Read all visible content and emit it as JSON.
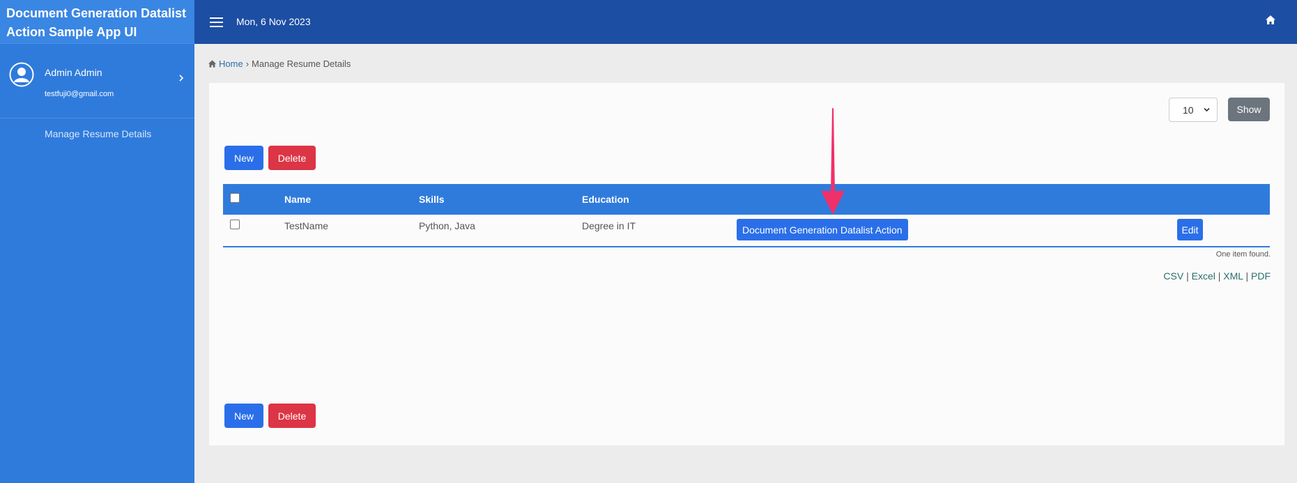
{
  "app": {
    "title": "Document Generation Datalist Action Sample App UI"
  },
  "user": {
    "name": "Admin Admin",
    "email": "testfuji0@gmail.com"
  },
  "sidebar": {
    "items": [
      {
        "label": "Manage Resume Details"
      }
    ]
  },
  "topbar": {
    "date": "Mon, 6 Nov 2023"
  },
  "breadcrumb": {
    "home": "Home",
    "separator": "›",
    "current": "Manage Resume Details"
  },
  "list": {
    "page_size": "10",
    "show_label": "Show",
    "new_label": "New",
    "delete_label": "Delete",
    "columns": {
      "name": "Name",
      "skills": "Skills",
      "education": "Education"
    },
    "rows": [
      {
        "name": "TestName",
        "skills": "Python, Java",
        "education": "Degree in IT",
        "action_label": "Document Generation Datalist Action",
        "edit_label": "Edit"
      }
    ],
    "items_found": "One item found.",
    "exports": {
      "csv": "CSV",
      "excel": "Excel",
      "xml": "XML",
      "pdf": "PDF",
      "separator": "|"
    }
  },
  "colors": {
    "sidebar": "#2f7bdc",
    "topbar": "#1c4ea3",
    "primary": "#2a6fe9",
    "danger": "#dc3545",
    "secondary": "#6c757d",
    "annotation_arrow": "#f0306a"
  }
}
